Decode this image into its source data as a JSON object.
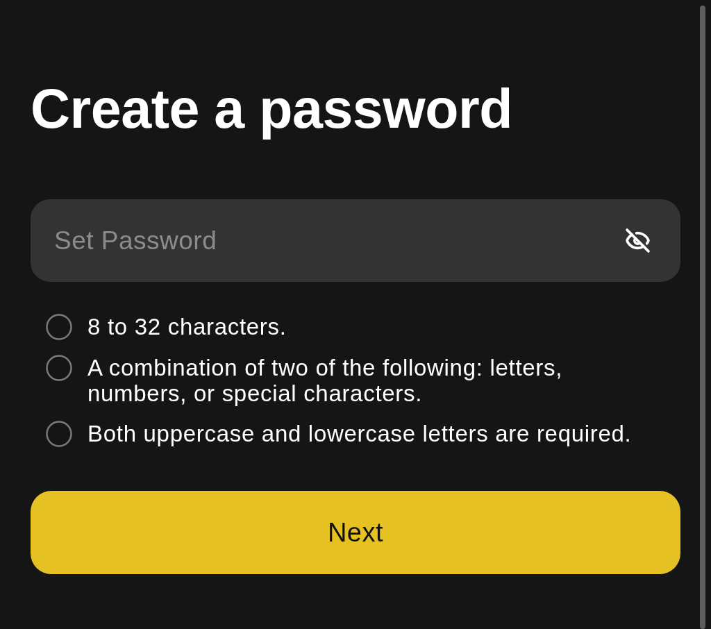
{
  "title": "Create a password",
  "password_field": {
    "placeholder": "Set Password",
    "password_visible": false
  },
  "requirements": [
    {
      "text": "8 to 32 characters.",
      "checked": false
    },
    {
      "text": "A combination of two of the following: letters, numbers, or special characters.",
      "checked": false
    },
    {
      "text": "Both uppercase and lowercase letters are required.",
      "checked": false
    }
  ],
  "next_button": {
    "label": "Next"
  }
}
